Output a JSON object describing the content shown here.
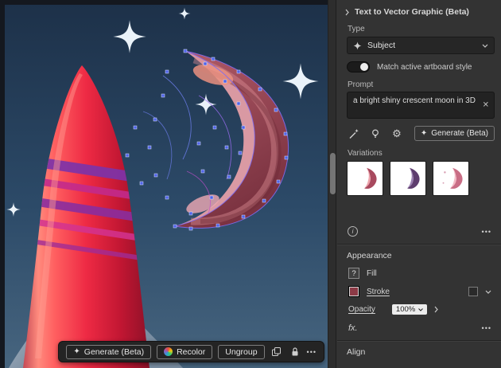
{
  "canvas_toolbar": {
    "generate": "Generate (Beta)",
    "recolor": "Recolor",
    "ungroup": "Ungroup"
  },
  "panel": {
    "title": "Text to Vector Graphic (Beta)",
    "type_label": "Type",
    "type_value": "Subject",
    "match_toggle_label": "Match active artboard style",
    "prompt_label": "Prompt",
    "prompt_value": "a bright shiny crescent moon in 3D",
    "generate_button": "Generate (Beta)",
    "variations_label": "Variations",
    "appearance_title": "Appearance",
    "fill_label": "Fill",
    "stroke_label": "Stroke",
    "opacity_label": "Opacity",
    "opacity_value": "100%",
    "fx_label": "fx.",
    "align_title": "Align"
  },
  "icons": {
    "clear": "✕",
    "more": "•••",
    "question": "?",
    "info": "i",
    "gear": "⚙",
    "sparkle": "✦"
  },
  "colors": {
    "panel_bg": "#333333",
    "sky_top": "#1d3149",
    "sky_bottom": "#47657f",
    "rocket_red": "#ee2a44",
    "moon_maroon": "#9c4a57",
    "selection_blue": "#4f63e8"
  }
}
